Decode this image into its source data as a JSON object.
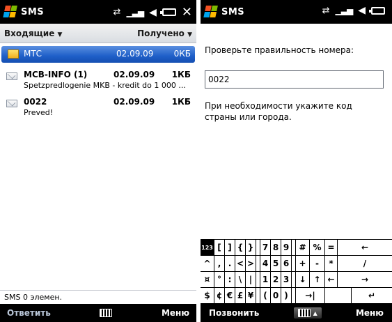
{
  "left": {
    "titlebar": {
      "title": "SMS"
    },
    "header": {
      "folder": "Входящие",
      "sort": "Получено"
    },
    "messages": [
      {
        "sender": "МТС",
        "date": "02.09.09",
        "size": "0КБ",
        "preview": "",
        "selected": true
      },
      {
        "sender": "MCB-INFO (1)",
        "date": "02.09.09",
        "size": "1КБ",
        "preview": "Spetzpredlogenie MKB - kredit do 1 000 ...",
        "selected": false
      },
      {
        "sender": "0022",
        "date": "02.09.09",
        "size": "1КБ",
        "preview": "Preved!",
        "selected": false
      }
    ],
    "status": "SMS  0 элемен.",
    "softkeys": {
      "left": "Ответить",
      "right": "Меню"
    }
  },
  "right": {
    "titlebar": {
      "title": "SMS"
    },
    "prompt": "Проверьте правильность номера:",
    "number_value": "0022",
    "hint_line1": "При необходимости укажите код",
    "hint_line2": "страны или города.",
    "softkeys": {
      "left": "Позвонить",
      "right": "Меню"
    },
    "keyboard": {
      "row1": [
        "[",
        "]",
        "{",
        "}",
        "7",
        "8",
        "9",
        "#",
        "%",
        "=",
        "←"
      ],
      "row2": [
        "^",
        ",",
        ".",
        "<",
        ">",
        "4",
        "5",
        "6",
        "+",
        "-",
        "*",
        "/"
      ],
      "row3": [
        "¤",
        "°",
        ":",
        "\\",
        "|",
        "1",
        "2",
        "3",
        "↓",
        "↑",
        "←",
        "→"
      ],
      "row4": [
        "$",
        "¢",
        "€",
        "£",
        "¥",
        "(",
        "0",
        ")",
        "→|",
        "↵"
      ],
      "mode": "123"
    }
  },
  "colors": {
    "accent": "#1f5fc8",
    "titlebar": "#000000"
  }
}
